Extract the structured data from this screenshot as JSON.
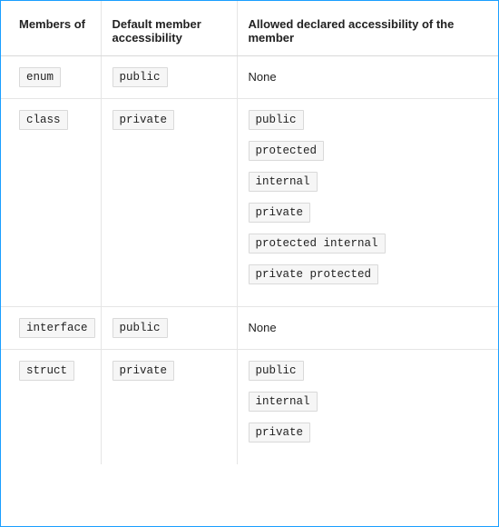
{
  "headers": {
    "members": "Members of",
    "default": "Default member accessibility",
    "allowed": "Allowed declared accessibility of the member"
  },
  "rows": [
    {
      "members": "enum",
      "default": "public",
      "allowed_plain": "None",
      "allowed_codes": []
    },
    {
      "members": "class",
      "default": "private",
      "allowed_plain": null,
      "allowed_codes": [
        "public",
        "protected",
        "internal",
        "private",
        "protected internal",
        "private protected"
      ]
    },
    {
      "members": "interface",
      "default": "public",
      "allowed_plain": "None",
      "allowed_codes": []
    },
    {
      "members": "struct",
      "default": "private",
      "allowed_plain": null,
      "allowed_codes": [
        "public",
        "internal",
        "private"
      ]
    }
  ]
}
